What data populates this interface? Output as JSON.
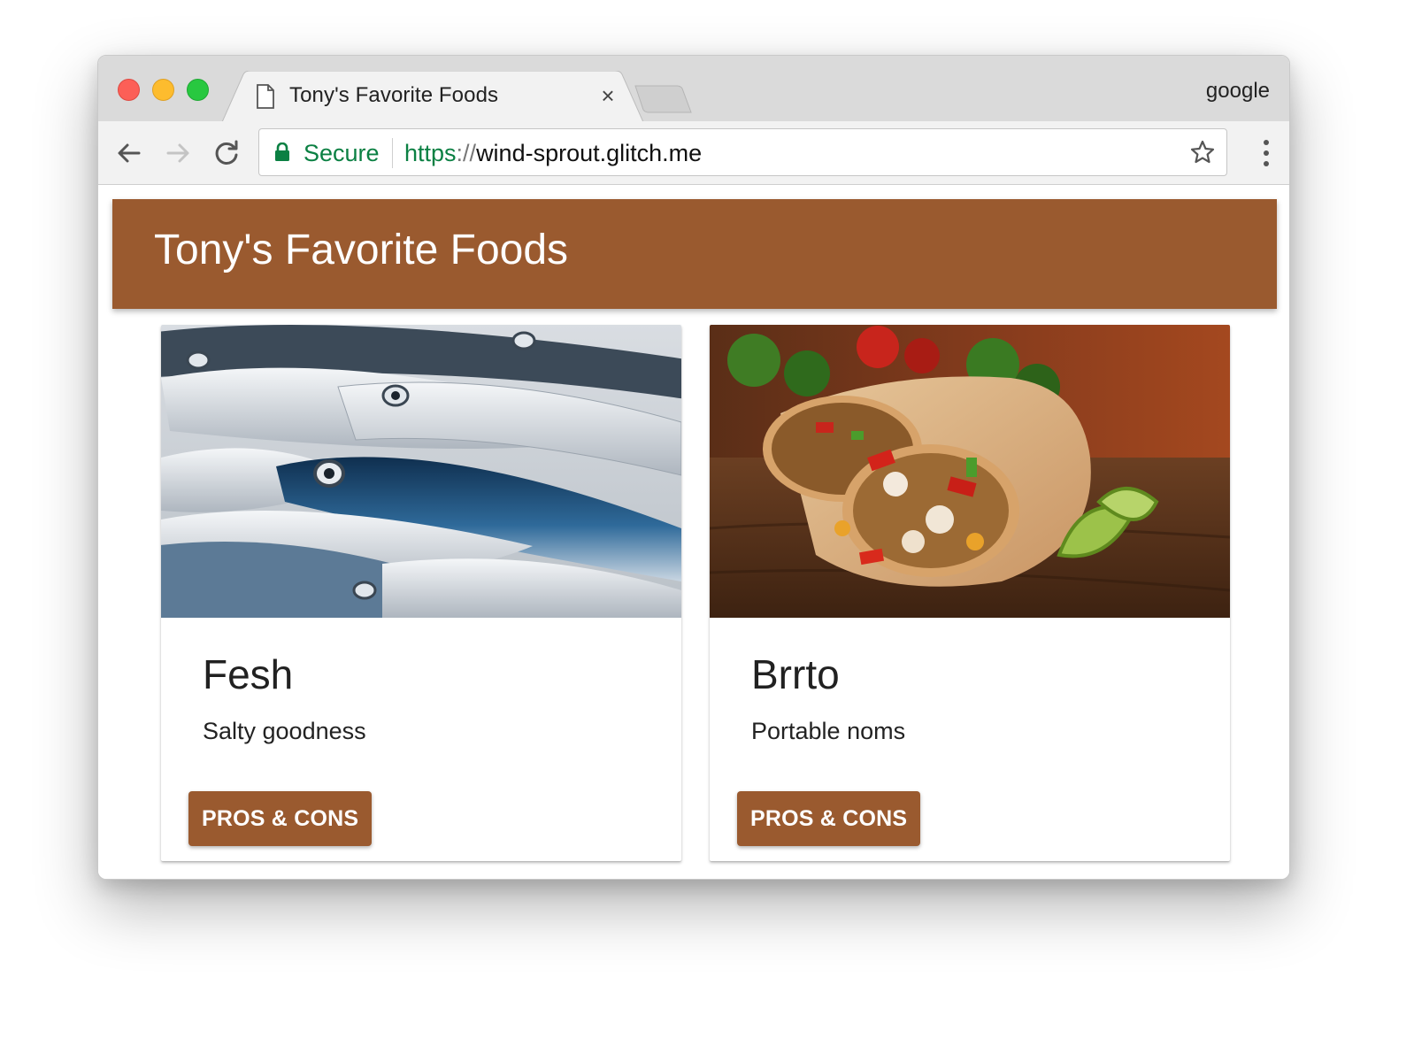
{
  "browser": {
    "tab_title": "Tony's Favorite Foods",
    "tab_close": "×",
    "profile_label": "google",
    "security_label": "Secure",
    "url_scheme": "https",
    "url_separator": "://",
    "url_host": "wind-sprout.glitch.me",
    "icons": [
      "back-arrow-icon",
      "forward-arrow-icon",
      "reload-icon",
      "lock-icon",
      "star-icon",
      "more-vert-icon",
      "document-icon",
      "close-icon"
    ],
    "colors": {
      "secure_green": "#0b8043",
      "chrome_gray": "#dadada",
      "toolbar_gray": "#f2f2f2"
    }
  },
  "page": {
    "header_title": "Tony's Favorite Foods",
    "accent_color": "#9a5a2f",
    "cards": [
      {
        "title": "Fesh",
        "subtitle": "Salty goodness",
        "button_label": "PROS & CONS",
        "image": "fish photo"
      },
      {
        "title": "Brrto",
        "subtitle": "Portable noms",
        "button_label": "PROS & CONS",
        "image": "burrito photo"
      }
    ]
  }
}
